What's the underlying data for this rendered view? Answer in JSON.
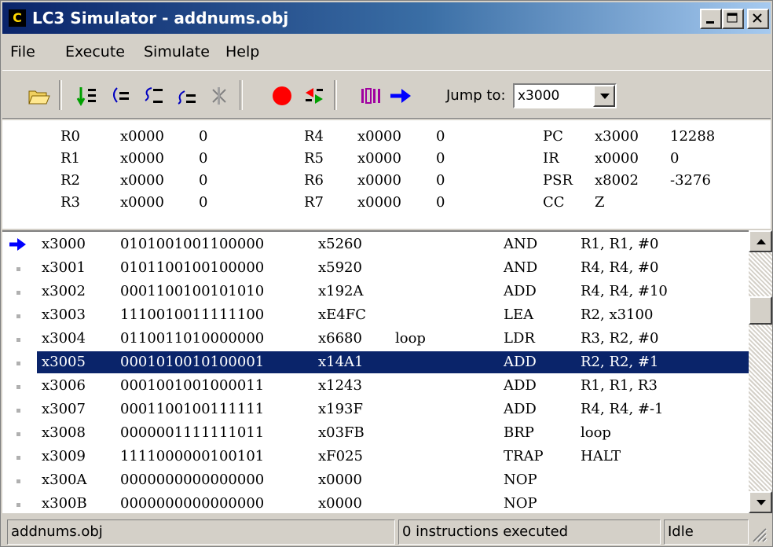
{
  "window": {
    "title": "LC3 Simulator - addnums.obj",
    "app_icon_glyph": "C",
    "controls": [
      "minimize-icon",
      "maximize-icon",
      "close-icon"
    ]
  },
  "menu": [
    "File",
    "Execute",
    "Simulate",
    "Help"
  ],
  "toolbar": {
    "tools": [
      {
        "name": "open-folder-icon"
      },
      {
        "name": "run-icon"
      },
      {
        "name": "step-over-icon"
      },
      {
        "name": "step-into-icon"
      },
      {
        "name": "step-out-icon"
      },
      {
        "name": "stop-icon"
      },
      {
        "name": "breakpoint-icon"
      },
      {
        "name": "registers-icon"
      },
      {
        "name": "memory-icon"
      },
      {
        "name": "jump-arrow-icon"
      }
    ],
    "jump_label": "Jump to:",
    "jump_value": "x3000",
    "colors": {
      "breakpoint": "#ff0000",
      "arrow": "#0000ff",
      "run": "#00a000",
      "memory": "#a000a0"
    }
  },
  "registers": [
    [
      {
        "name": "R0",
        "hex": "x0000",
        "dec": "0"
      },
      {
        "name": "R4",
        "hex": "x0000",
        "dec": "0"
      },
      {
        "name": "PC",
        "hex": "x3000",
        "dec": "12288"
      }
    ],
    [
      {
        "name": "R1",
        "hex": "x0000",
        "dec": "0"
      },
      {
        "name": "R5",
        "hex": "x0000",
        "dec": "0"
      },
      {
        "name": "IR",
        "hex": "x0000",
        "dec": "0"
      }
    ],
    [
      {
        "name": "R2",
        "hex": "x0000",
        "dec": "0"
      },
      {
        "name": "R6",
        "hex": "x0000",
        "dec": "0"
      },
      {
        "name": "PSR",
        "hex": "x8002",
        "dec": "-3276"
      }
    ],
    [
      {
        "name": "R3",
        "hex": "x0000",
        "dec": "0"
      },
      {
        "name": "R7",
        "hex": "x0000",
        "dec": "0"
      },
      {
        "name": "CC",
        "hex": "Z",
        "dec": ""
      }
    ]
  ],
  "memory": [
    {
      "addr": "x3000",
      "bin": "0101001001100000",
      "hex": "x5260",
      "label": "",
      "op": "AND",
      "args": "R1, R1, #0",
      "pc": true,
      "selected": false
    },
    {
      "addr": "x3001",
      "bin": "0101100100100000",
      "hex": "x5920",
      "label": "",
      "op": "AND",
      "args": "R4, R4, #0",
      "pc": false,
      "selected": false
    },
    {
      "addr": "x3002",
      "bin": "0001100100101010",
      "hex": "x192A",
      "label": "",
      "op": "ADD",
      "args": "R4, R4, #10",
      "pc": false,
      "selected": false
    },
    {
      "addr": "x3003",
      "bin": "1110010011111100",
      "hex": "xE4FC",
      "label": "",
      "op": "LEA",
      "args": "R2, x3100",
      "pc": false,
      "selected": false
    },
    {
      "addr": "x3004",
      "bin": "0110011010000000",
      "hex": "x6680",
      "label": "loop",
      "op": "LDR",
      "args": "R3, R2, #0",
      "pc": false,
      "selected": false
    },
    {
      "addr": "x3005",
      "bin": "0001010010100001",
      "hex": "x14A1",
      "label": "",
      "op": "ADD",
      "args": "R2, R2, #1",
      "pc": false,
      "selected": true
    },
    {
      "addr": "x3006",
      "bin": "0001001001000011",
      "hex": "x1243",
      "label": "",
      "op": "ADD",
      "args": "R1, R1, R3",
      "pc": false,
      "selected": false
    },
    {
      "addr": "x3007",
      "bin": "0001100100111111",
      "hex": "x193F",
      "label": "",
      "op": "ADD",
      "args": "R4, R4, #-1",
      "pc": false,
      "selected": false
    },
    {
      "addr": "x3008",
      "bin": "0000001111111011",
      "hex": "x03FB",
      "label": "",
      "op": "BRP",
      "args": "loop",
      "pc": false,
      "selected": false
    },
    {
      "addr": "x3009",
      "bin": "1111000000100101",
      "hex": "xF025",
      "label": "",
      "op": "TRAP",
      "args": "HALT",
      "pc": false,
      "selected": false
    },
    {
      "addr": "x300A",
      "bin": "0000000000000000",
      "hex": "x0000",
      "label": "",
      "op": "NOP",
      "args": "",
      "pc": false,
      "selected": false
    },
    {
      "addr": "x300B",
      "bin": "0000000000000000",
      "hex": "x0000",
      "label": "",
      "op": "NOP",
      "args": "",
      "pc": false,
      "selected": false
    }
  ],
  "status": {
    "file": "addnums.obj",
    "executed": "0 instructions executed",
    "state": "Idle"
  }
}
